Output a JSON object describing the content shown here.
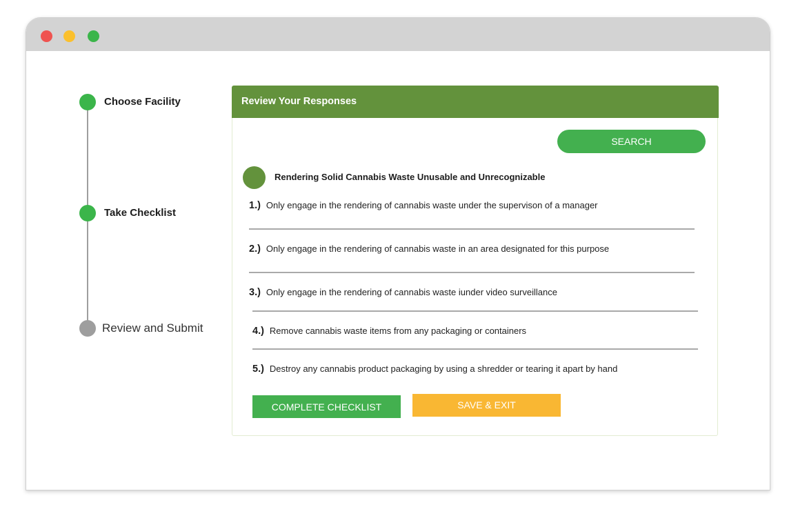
{
  "window": {
    "controls": [
      "close",
      "minimize",
      "maximize"
    ],
    "colors": {
      "close": "#ef5350",
      "minimize": "#fbc02d",
      "maximize": "#3bb54a"
    }
  },
  "stepper": {
    "steps": [
      {
        "label": "Choose Facility",
        "status": "complete"
      },
      {
        "label": "Take Checklist",
        "status": "complete"
      },
      {
        "label": "Review and Submit",
        "status": "pending"
      }
    ]
  },
  "panel": {
    "header": "Review Your Responses",
    "search_label": "SEARCH",
    "section_title": "Rendering Solid Cannabis Waste Unusable and Unrecognizable",
    "items": [
      {
        "num": "1.)",
        "text": "Only engage in the rendering of cannabis waste under the supervison of a manager"
      },
      {
        "num": "2.)",
        "text": "Only engage in the rendering of cannabis waste in an area designated for this purpose"
      },
      {
        "num": "3.)",
        "text": "Only engage in the rendering of cannabis waste iunder video surveillance"
      },
      {
        "num": "4.)",
        "text": "Remove cannabis waste items from any packaging or containers"
      },
      {
        "num": "5.)",
        "text": "Destroy any cannabis product packaging by using a shredder or tearing it apart by hand"
      }
    ],
    "complete_label": "COMPLETE CHECKLIST",
    "save_label": "SAVE & EXIT"
  },
  "colors": {
    "primary_green": "#43b04f",
    "header_green": "#63923c",
    "accent_yellow": "#f9b733",
    "pending_gray": "#9e9e9e"
  }
}
